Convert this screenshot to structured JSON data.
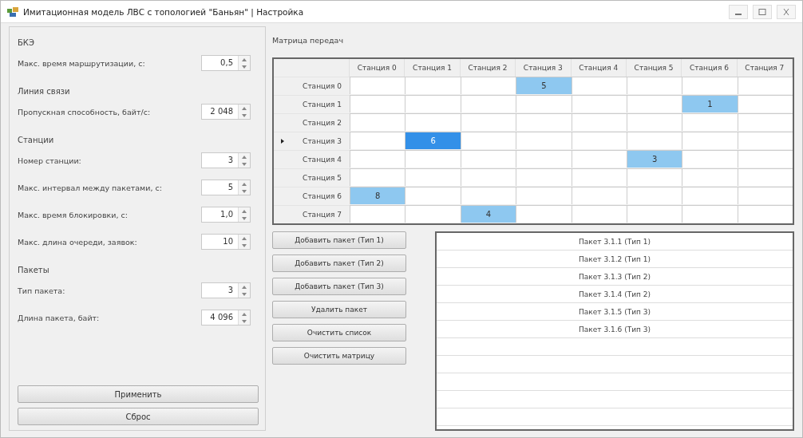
{
  "window": {
    "title": "Имитационная модель ЛВС с топологией \"Баньян\" | Настройка"
  },
  "settings": [
    {
      "kind": "section",
      "label": "БКЭ"
    },
    {
      "kind": "spinner",
      "label": "Макс. время маршрутизации, с:",
      "value": "0,5"
    },
    {
      "kind": "section",
      "label": "Линия связи"
    },
    {
      "kind": "spinner",
      "label": "Пропускная способность, байт/с:",
      "value": "2 048"
    },
    {
      "kind": "section",
      "label": "Станции"
    },
    {
      "kind": "spinner",
      "label": "Номер станции:",
      "value": "3"
    },
    {
      "kind": "spinner",
      "label": "Макс. интервал между пакетами, с:",
      "value": "5"
    },
    {
      "kind": "spinner",
      "label": "Макс. время блокировки, с:",
      "value": "1,0"
    },
    {
      "kind": "spinner",
      "label": "Макс. длина очереди, заявок:",
      "value": "10"
    },
    {
      "kind": "section",
      "label": "Пакеты"
    },
    {
      "kind": "spinner",
      "label": "Тип пакета:",
      "value": "3"
    },
    {
      "kind": "spinner",
      "label": "Длина пакета, байт:",
      "value": "4 096"
    }
  ],
  "settings_buttons": [
    "Применить",
    "Сброс"
  ],
  "matrix": {
    "title": "Матрица передач",
    "columns": [
      "Станция 0",
      "Станция 1",
      "Станция 2",
      "Станция 3",
      "Станция 4",
      "Станция 5",
      "Станция 6",
      "Станция 7"
    ],
    "rows": [
      {
        "label": "Станция 0",
        "current": false,
        "cells": [
          {
            "selected": false
          },
          {
            "selected": false
          },
          {
            "selected": false
          },
          {
            "value": "5",
            "selected": false
          },
          {
            "selected": false
          },
          {
            "selected": false
          },
          {
            "selected": false
          },
          {
            "selected": false
          }
        ]
      },
      {
        "label": "Станция 1",
        "current": false,
        "cells": [
          {
            "selected": false
          },
          {
            "selected": false
          },
          {
            "selected": false
          },
          {
            "selected": false
          },
          {
            "selected": false
          },
          {
            "selected": false
          },
          {
            "value": "1",
            "selected": false
          },
          {
            "selected": false
          }
        ]
      },
      {
        "label": "Станция 2",
        "current": false,
        "cells": [
          {
            "selected": false
          },
          {
            "selected": false
          },
          {
            "selected": false
          },
          {
            "selected": false
          },
          {
            "selected": false
          },
          {
            "selected": false
          },
          {
            "selected": false
          },
          {
            "selected": false
          }
        ]
      },
      {
        "label": "Станция 3",
        "current": true,
        "cells": [
          {
            "selected": false
          },
          {
            "value": "6",
            "selected": true
          },
          {
            "selected": false
          },
          {
            "selected": false
          },
          {
            "selected": false
          },
          {
            "selected": false
          },
          {
            "selected": false
          },
          {
            "selected": false
          }
        ]
      },
      {
        "label": "Станция 4",
        "current": false,
        "cells": [
          {
            "selected": false
          },
          {
            "selected": false
          },
          {
            "selected": false
          },
          {
            "selected": false
          },
          {
            "selected": false
          },
          {
            "value": "3",
            "selected": false
          },
          {
            "selected": false
          },
          {
            "selected": false
          }
        ]
      },
      {
        "label": "Станция 5",
        "current": false,
        "cells": [
          {
            "selected": false
          },
          {
            "selected": false
          },
          {
            "selected": false
          },
          {
            "selected": false
          },
          {
            "selected": false
          },
          {
            "selected": false
          },
          {
            "selected": false
          },
          {
            "selected": false
          }
        ]
      },
      {
        "label": "Станция 6",
        "current": false,
        "cells": [
          {
            "value": "8",
            "selected": false
          },
          {
            "selected": false
          },
          {
            "selected": false
          },
          {
            "selected": false
          },
          {
            "selected": false
          },
          {
            "selected": false
          },
          {
            "selected": false
          },
          {
            "selected": false
          }
        ]
      },
      {
        "label": "Станция 7",
        "current": false,
        "cells": [
          {
            "selected": false
          },
          {
            "selected": false
          },
          {
            "value": "4",
            "selected": false
          },
          {
            "selected": false
          },
          {
            "selected": false
          },
          {
            "selected": false
          },
          {
            "selected": false
          },
          {
            "selected": false
          }
        ]
      }
    ]
  },
  "packet_buttons": [
    "Добавить пакет (Тип 1)",
    "Добавить пакет (Тип 2)",
    "Добавить пакет (Тип 3)",
    "Удалить пакет",
    "Очистить список",
    "Очистить матрицу"
  ],
  "packets": [
    "Пакет 3.1.1 (Тип 1)",
    "Пакет 3.1.2 (Тип 1)",
    "Пакет 3.1.3 (Тип 2)",
    "Пакет 3.1.4 (Тип 2)",
    "Пакет 3.1.5 (Тип 3)",
    "Пакет 3.1.6 (Тип 3)"
  ]
}
